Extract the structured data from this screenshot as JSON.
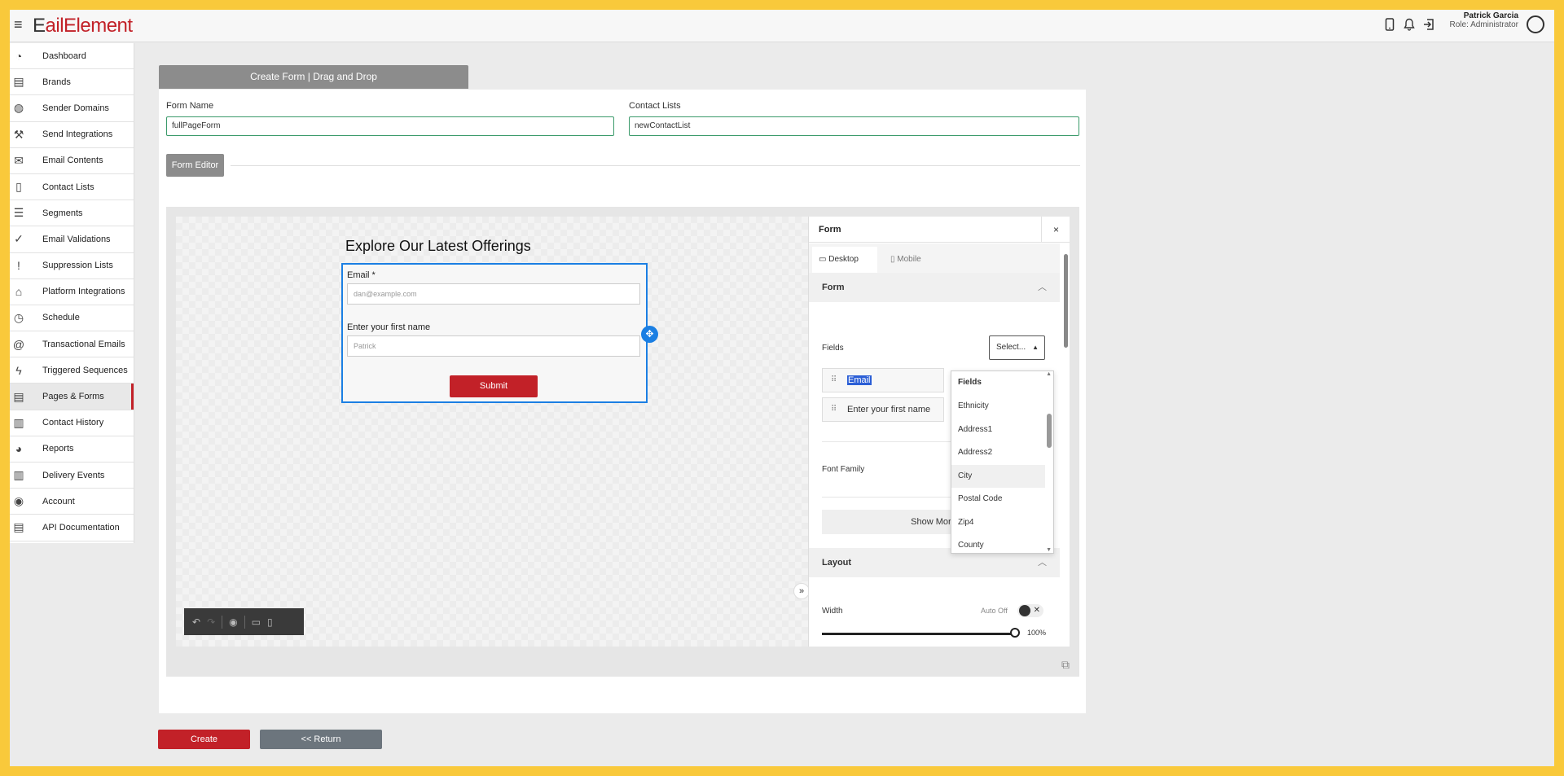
{
  "app": {
    "logo_prefix": "E",
    "logo_rest": "ailElement",
    "user_name": "Patrick Garcia",
    "user_role": "Role: Administrator"
  },
  "sidebar": {
    "items": [
      {
        "label": "Dashboard",
        "icon": "gauge-icon"
      },
      {
        "label": "Brands",
        "icon": "card-icon"
      },
      {
        "label": "Sender Domains",
        "icon": "globe-icon"
      },
      {
        "label": "Send Integrations",
        "icon": "wrench-icon"
      },
      {
        "label": "Email Contents",
        "icon": "envelope-icon"
      },
      {
        "label": "Contact Lists",
        "icon": "book-icon"
      },
      {
        "label": "Segments",
        "icon": "list-icon"
      },
      {
        "label": "Email Validations",
        "icon": "check-circle-icon"
      },
      {
        "label": "Suppression Lists",
        "icon": "exclamation-circle-icon"
      },
      {
        "label": "Platform Integrations",
        "icon": "tag-icon"
      },
      {
        "label": "Schedule",
        "icon": "clock-icon"
      },
      {
        "label": "Transactional Emails",
        "icon": "at-icon"
      },
      {
        "label": "Triggered Sequences",
        "icon": "lightning-icon"
      },
      {
        "label": "Pages & Forms",
        "icon": "document-icon"
      },
      {
        "label": "Contact History",
        "icon": "clipboard-icon"
      },
      {
        "label": "Reports",
        "icon": "pie-chart-icon"
      },
      {
        "label": "Delivery Events",
        "icon": "bar-chart-icon"
      },
      {
        "label": "Account",
        "icon": "user-circle-icon"
      },
      {
        "label": "API Documentation",
        "icon": "api-doc-icon"
      }
    ],
    "active_label": "Pages & Forms"
  },
  "page": {
    "header_tab": "Create Form | Drag and Drop",
    "form_name_label": "Form Name",
    "form_name_value": "fullPageForm",
    "contact_lists_label": "Contact Lists",
    "contact_lists_value": "newContactList",
    "form_editor_label": "Form Editor",
    "create_button": "Create",
    "return_button": "<< Return"
  },
  "canvas": {
    "form_title": "Explore Our Latest Offerings",
    "email_label": "Email *",
    "email_placeholder": "dan@example.com",
    "firstname_label": "Enter your first name",
    "firstname_placeholder": "Patrick",
    "submit_label": "Submit"
  },
  "panel": {
    "title": "Form",
    "close": "×",
    "tab_desktop": "Desktop",
    "tab_mobile": "Mobile",
    "section_form": "Form",
    "fields_label": "Fields",
    "select_label": "Select...",
    "field_items": [
      "Email",
      "Enter your first name"
    ],
    "font_family_label": "Font Family",
    "show_more": "Show More",
    "section_layout": "Layout",
    "width_label": "Width",
    "auto_off": "Auto Off",
    "width_value": "100%"
  },
  "dropdown": {
    "header": "Fields",
    "options": [
      "Ethnicity",
      "Address1",
      "Address2",
      "City",
      "Postal Code",
      "Zip4",
      "County"
    ],
    "hovered": "City"
  }
}
